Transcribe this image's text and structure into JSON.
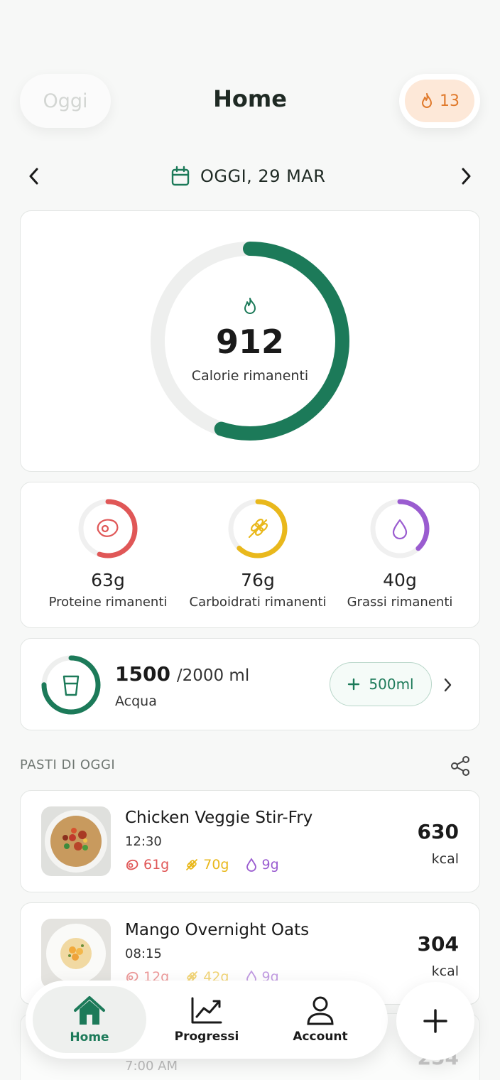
{
  "header": {
    "left_pill_label": "Oggi",
    "title": "Home",
    "streak_count": "13",
    "streak_icon": "flame-icon"
  },
  "date_nav": {
    "prev_icon": "chevron-left-icon",
    "calendar_icon": "calendar-icon",
    "date_label": "OGGI, 29 MAR",
    "next_icon": "chevron-right-icon"
  },
  "calories": {
    "value": "912",
    "label": "Calorie rimanenti",
    "icon": "flame-icon",
    "progress_fraction": 0.55,
    "color": "#1c7a59"
  },
  "macros": [
    {
      "value": "63g",
      "label": "Proteine rimanenti",
      "icon": "steak-icon",
      "color": "#e05757",
      "progress_fraction": 0.55
    },
    {
      "value": "76g",
      "label": "Carboidrati rimanenti",
      "icon": "wheat-icon",
      "color": "#e9b81c",
      "progress_fraction": 0.62
    },
    {
      "value": "40g",
      "label": "Grassi rimanenti",
      "icon": "drop-icon",
      "color": "#9a5cd0",
      "progress_fraction": 0.38
    }
  ],
  "water": {
    "current": "1500",
    "target": "/2000 ml",
    "label": "Acqua",
    "add_button": "500ml",
    "progress_fraction": 0.75,
    "icon": "glass-icon"
  },
  "meals_section": {
    "title": "PASTI DI OGGI",
    "share_icon": "share-icon"
  },
  "meals": [
    {
      "name": "Chicken Veggie Stir-Fry",
      "time": "12:30",
      "protein": "61g",
      "carbs": "70g",
      "fat": "9g",
      "kcal": "630",
      "unit": "kcal"
    },
    {
      "name": "Mango Overnight Oats",
      "time": "08:15",
      "protein": "12g",
      "carbs": "42g",
      "fat": "9g",
      "kcal": "304",
      "unit": "kcal"
    },
    {
      "time": "7:00 AM",
      "kcal": "254"
    }
  ],
  "bottom_nav": {
    "items": [
      {
        "label": "Home",
        "icon": "home-icon"
      },
      {
        "label": "Progressi",
        "icon": "chart-icon"
      },
      {
        "label": "Account",
        "icon": "user-icon"
      }
    ],
    "fab_icon": "plus-icon"
  },
  "colors": {
    "accent": "#1c7a59",
    "protein": "#e05757",
    "carbs": "#e9b81c",
    "fat": "#9a5cd0",
    "streak": "#e07a2c"
  }
}
